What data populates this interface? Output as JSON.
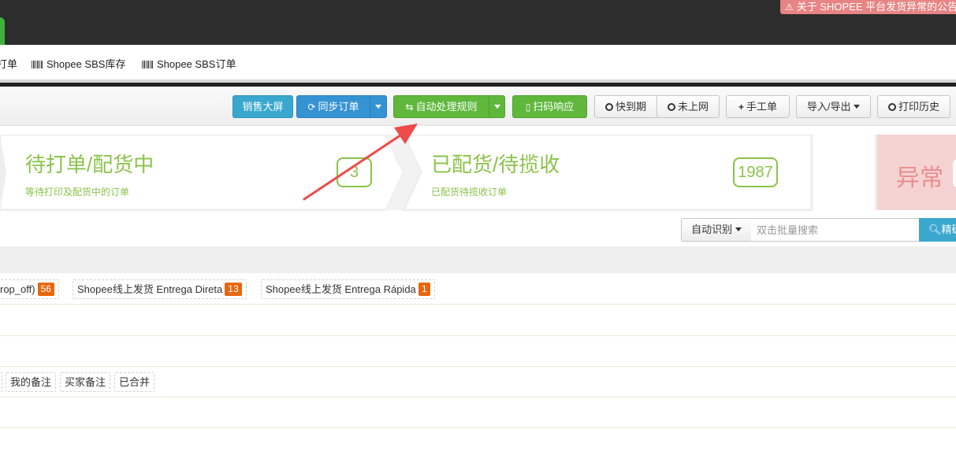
{
  "topbar": {
    "notice_text": "关于 SHOPEE 平台发货异常的公告",
    "notice_icon": "warning-icon",
    "accent_color": "#3db33d",
    "notice_color": "#e88484"
  },
  "subnav": {
    "items": [
      {
        "label": "打单"
      },
      {
        "label": "Shopee SBS库存",
        "icon": "barcode-icon"
      },
      {
        "label": "Shopee SBS订单",
        "icon": "barcode-icon"
      }
    ]
  },
  "toolbar": {
    "sales_screen": "销售大屏",
    "sync_orders": "同步订单",
    "auto_rules": "自动处理规则",
    "scan_response": "扫码响应",
    "expiring": "快到期",
    "not_online": "未上网",
    "manual_order": "手工单",
    "import_export": "导入/导出",
    "print_history": "打印历史"
  },
  "stats": {
    "pending_print": {
      "title": "待打单/配货中",
      "subtitle": "等待打印及配货中的订单",
      "count": "3"
    },
    "picked": {
      "title": "已配货/待揽收",
      "subtitle": "已配货待揽收订单",
      "count": "1987"
    },
    "abnormal": {
      "title": "异常"
    },
    "count_color": "#8bc34a"
  },
  "search": {
    "mode_label": "自动识别",
    "placeholder": "双击批量搜索",
    "button_label": "精确"
  },
  "filters": {
    "shipping": [
      {
        "label": "rop_off)",
        "count": "56"
      },
      {
        "label": "Shopee线上发货 Entrega Direta",
        "count": "13"
      },
      {
        "label": "Shopee线上发货 Entrega Rápida",
        "count": "1"
      }
    ],
    "notes": [
      "我的备注",
      "买家备注",
      "已合并"
    ]
  }
}
